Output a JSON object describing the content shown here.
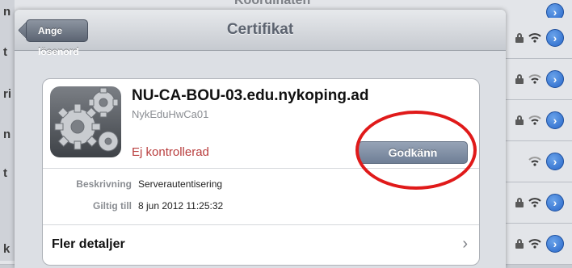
{
  "background": {
    "partial_title": "Koordinaten",
    "left_letters": [
      "n",
      "t",
      "ri",
      "n",
      "t",
      "k"
    ]
  },
  "navbar": {
    "back_label": "Ange lösenord",
    "title": "Certifikat"
  },
  "certificate": {
    "name": "NU-CA-BOU-03.edu.nykoping.ad",
    "issuer": "NykEduHwCa01",
    "status": "Ej kontrollerad",
    "accept_label": "Godkänn",
    "description_label": "Beskrivning",
    "description_value": "Serverautentisering",
    "valid_label": "Giltig till",
    "valid_value": "8 jun 2012 11:25:32",
    "more_label": "Fler detaljer",
    "more_chevron": "›"
  },
  "colors": {
    "status_red": "#b93e3e",
    "annotation_red": "#e01a1a",
    "accept_button": "#7f8da3"
  },
  "icons": [
    "gear-icon",
    "lock-icon",
    "wifi-icon",
    "chevron-right-icon"
  ]
}
